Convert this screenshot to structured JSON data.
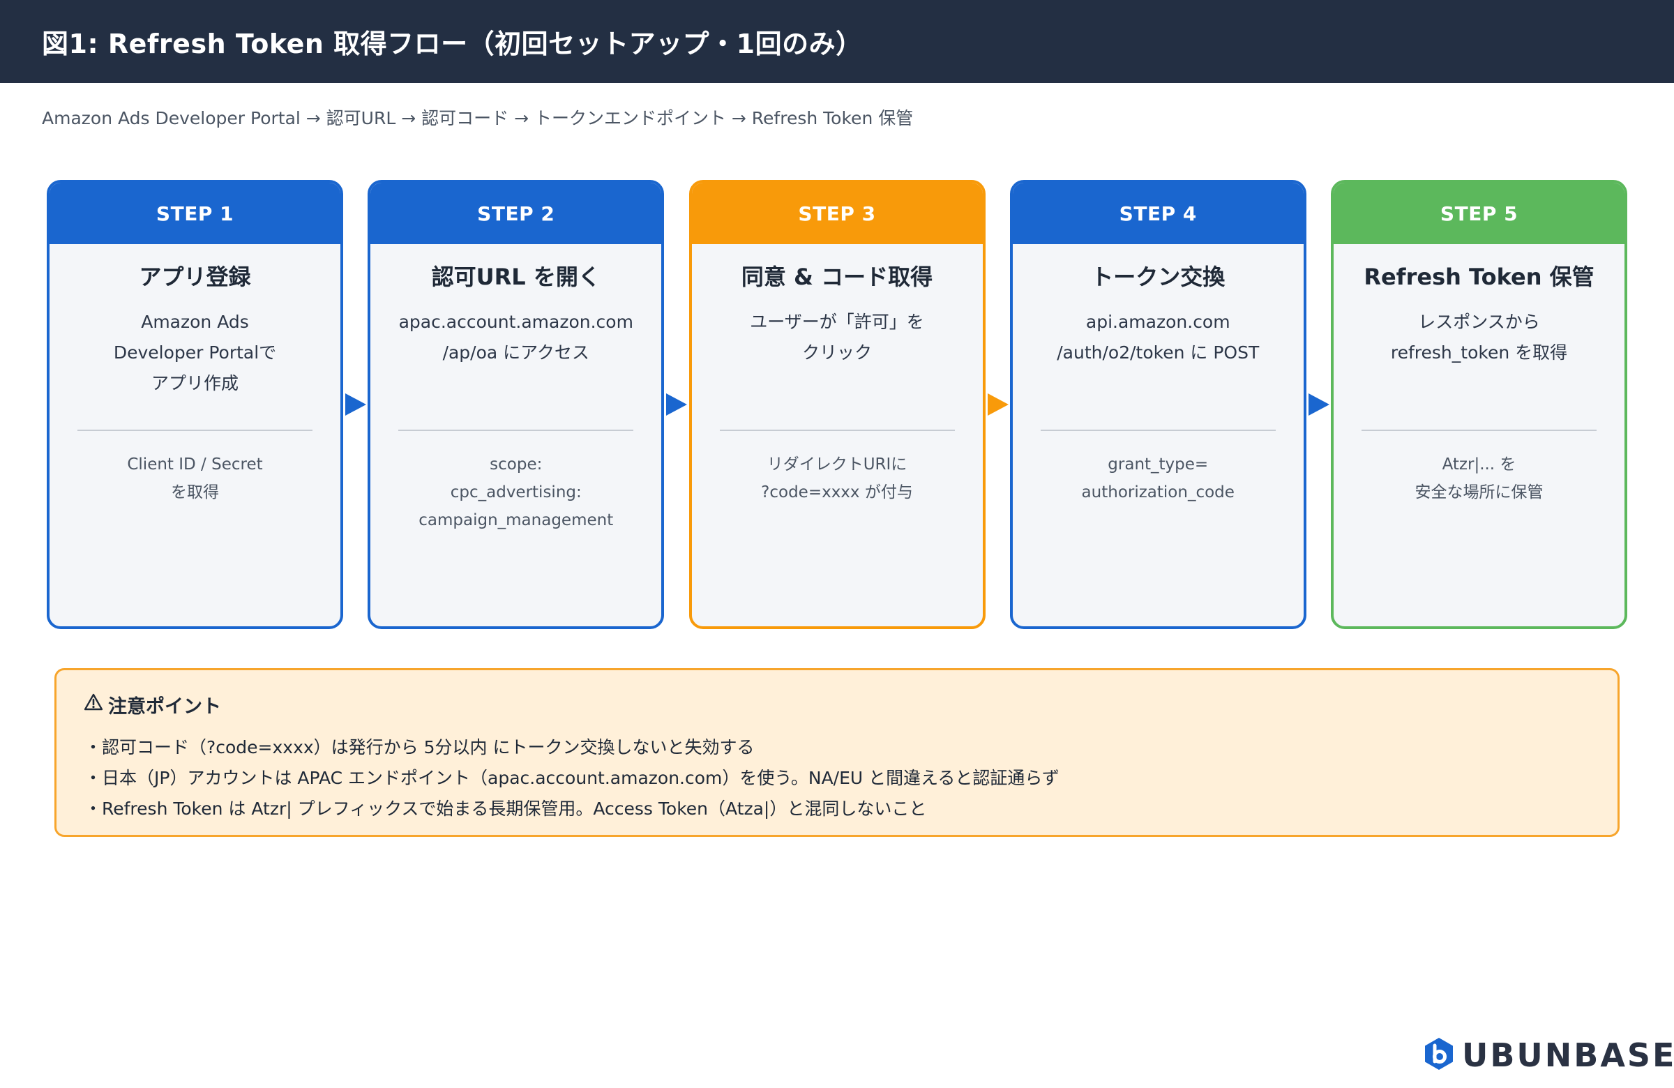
{
  "header": {
    "title": "図1: Refresh Token 取得フロー（初回セットアップ・1回のみ）",
    "subtitle": "Amazon Ads Developer Portal → 認可URL → 認可コード → トークンエンドポイント → Refresh Token 保管"
  },
  "colors": {
    "blue": "#1a66cf",
    "orange": "#f89a0a",
    "green": "#5cb85c",
    "title_bar": "#232f43",
    "caution_bg": "#fff0d9",
    "caution_border": "#f7a52c"
  },
  "steps": [
    {
      "step": "STEP 1",
      "title": "アプリ登録",
      "desc": [
        "Amazon Ads",
        "Developer Portalで",
        "アプリ作成"
      ],
      "note": [
        "Client ID / Secret",
        "を取得"
      ],
      "color": "#1a66cf"
    },
    {
      "step": "STEP 2",
      "title": "認可URL を開く",
      "desc": [
        "apac.account.amazon.com",
        "/ap/oa にアクセス"
      ],
      "note": [
        "scope:",
        "cpc_advertising:",
        "campaign_management"
      ],
      "color": "#1a66cf"
    },
    {
      "step": "STEP 3",
      "title": "同意 & コード取得",
      "desc": [
        "ユーザーが「許可」を",
        "クリック"
      ],
      "note": [
        "リダイレクトURIに",
        "?code=xxxx が付与"
      ],
      "color": "#f89a0a"
    },
    {
      "step": "STEP 4",
      "title": "トークン交換",
      "desc": [
        "api.amazon.com",
        "/auth/o2/token に POST"
      ],
      "note": [
        "grant_type=",
        "authorization_code"
      ],
      "color": "#1a66cf"
    },
    {
      "step": "STEP 5",
      "title": "Refresh Token 保管",
      "desc": [
        "レスポンスから",
        "refresh_token を取得"
      ],
      "note": [
        "Atzr|... を",
        "安全な場所に保管"
      ],
      "color": "#5cb85c"
    }
  ],
  "arrow_colors": [
    "#1a66cf",
    "#1a66cf",
    "#f89a0a",
    "#1a66cf"
  ],
  "caution": {
    "icon": "warning-icon",
    "title": "注意ポイント",
    "items": [
      "・認可コード（?code=xxxx）は発行から 5分以内 にトークン交換しないと失効する",
      "・日本（JP）アカウントは APAC エンドポイント（apac.account.amazon.com）を使う。NA/EU と間違えると認証通らず",
      "・Refresh Token は Atzr| プレフィックスで始まる長期保管用。Access Token（Atza|）と混同しないこと"
    ]
  },
  "logo": {
    "text": "UBUNBASE",
    "icon": "ubunbase-logo-icon"
  }
}
